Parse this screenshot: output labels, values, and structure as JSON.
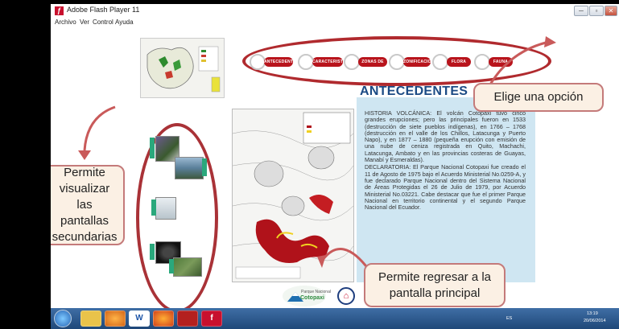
{
  "window": {
    "title": "Adobe Flash Player 11",
    "minimize_glyph": "─",
    "maximize_glyph": "▫",
    "close_glyph": "✕"
  },
  "menu": [
    "Archivo",
    "Ver",
    "Control",
    "Ayuda"
  ],
  "nav": {
    "options": [
      "ANTECEDENTES",
      "CARACTERISTICAS",
      "ZONAS DE VIDA",
      "ZONIFICACION",
      "FLORA",
      "FAUNA"
    ]
  },
  "section": {
    "title": "ANTECEDENTES",
    "paragraphs": [
      "HISTORIA VOLCÁNICA: El volcán Cotopaxi tuvo cinco grandes erupciones; pero las principales fueron en 1533 (destrucción de siete pueblos indígenas), en 1766 – 1768 (destrucción en el valle de los Chillos, Latacunga y Puerto Napo), y en 1877 – 1880 (pequeña erupción con emisión de una nube de ceniza registrada en Quito, Machachi, Latacunga, Ambato y en las provincias costeras de Guayas, Manabí y Esmeraldas).",
      "DECLARATORIA: El Parque Nacional Cotopaxi fue creado el 11 de Agosto de 1975 bajo el Acuerdo Ministerial No.0259-A, y fue declarado Parque Nacional dentro del Sistema Nacional de Áreas Protegidas el 26 de Julio de 1979, por Acuerdo Ministerial No.03221. Cabe destacar que fue el primer Parque Nacional en territorio continental y el segundo Parque Nacional del Ecuador."
    ]
  },
  "callouts": {
    "choose": "Elige una opción",
    "secondary": "Permite visualizar las pantallas secundarias",
    "home": "Permite regresar a la pantalla principal"
  },
  "logo": {
    "small": "Parque Nacional",
    "big": "Cotopaxi"
  },
  "taskbar": {
    "apps": [
      "explorer-icon",
      "media-player-icon",
      "word-icon",
      "firefox-icon",
      "acrobat-icon",
      "flash-icon"
    ],
    "word_glyph": "W",
    "flash_glyph": "f",
    "lang": "ES",
    "time": "13:19",
    "date": "20/06/2014"
  },
  "colors": {
    "accent_red": "#b02a2e",
    "title_blue": "#1b4a84",
    "panel_blue": "#cfe6f2",
    "callout_bg": "#fbf0e4"
  }
}
